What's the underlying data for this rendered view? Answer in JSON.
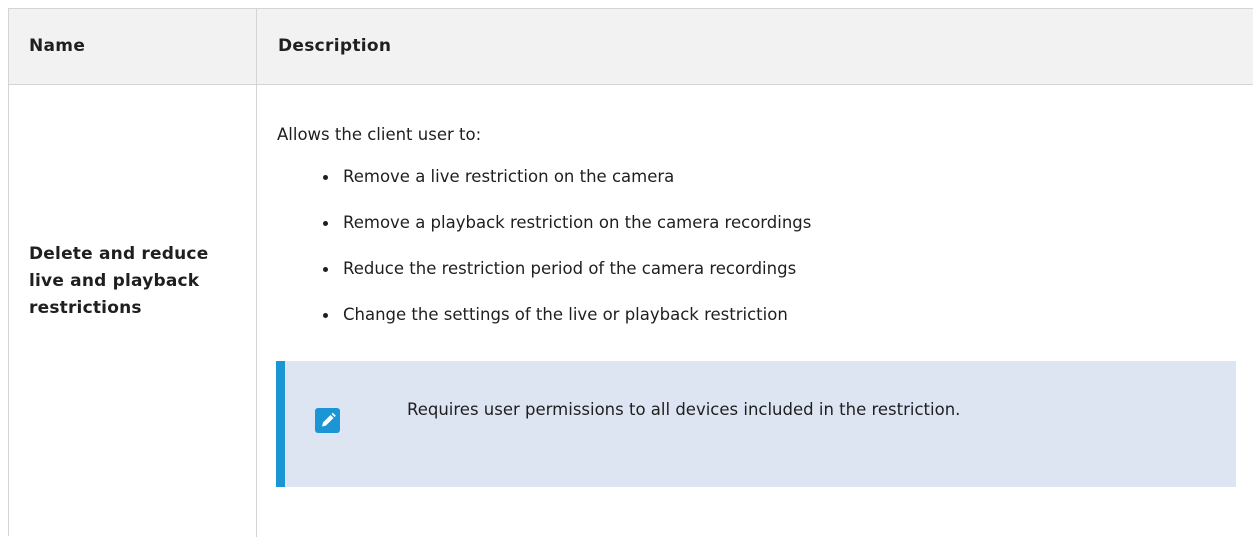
{
  "table": {
    "headers": {
      "name": "Name",
      "description": "Description"
    },
    "rows": [
      {
        "name": "Delete and reduce live and playback restrictions",
        "description": {
          "intro": "Allows the client user to:",
          "bullets": [
            "Remove a live restriction on the camera",
            "Remove a playback restriction on the camera recordings",
            "Reduce the restriction period of the camera recordings",
            "Change the settings of the live or playback restriction"
          ],
          "note": {
            "icon": "pencil-icon",
            "text": "Requires user permissions to all devices included in the restriction."
          }
        }
      }
    ]
  },
  "colors": {
    "header_bg": "#f2f2f2",
    "note_bg": "#dde5f2",
    "note_accent": "#1a96d4",
    "border": "#d4d4d4"
  }
}
